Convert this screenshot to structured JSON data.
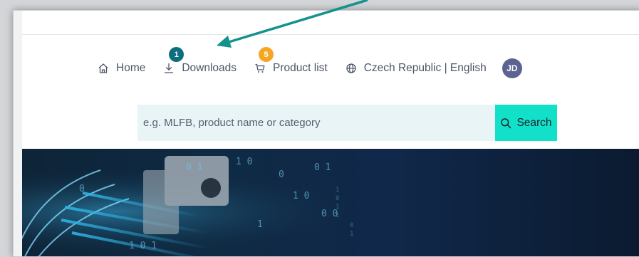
{
  "nav": {
    "items": [
      {
        "label": "Home",
        "icon": "home-icon"
      },
      {
        "label": "Downloads",
        "icon": "download-icon",
        "badge": "1",
        "badge_color": "#0d6f7d"
      },
      {
        "label": "Product list",
        "icon": "cart-icon",
        "badge": "5",
        "badge_color": "#f5a623"
      },
      {
        "label": "Czech Republic | English",
        "icon": "globe-icon"
      }
    ],
    "avatar_initials": "JD"
  },
  "search": {
    "placeholder": "e.g. MLFB, product name or category",
    "button_label": "Search",
    "button_color": "#13e0c8"
  },
  "annotation": {
    "arrow_color": "#13928e"
  }
}
